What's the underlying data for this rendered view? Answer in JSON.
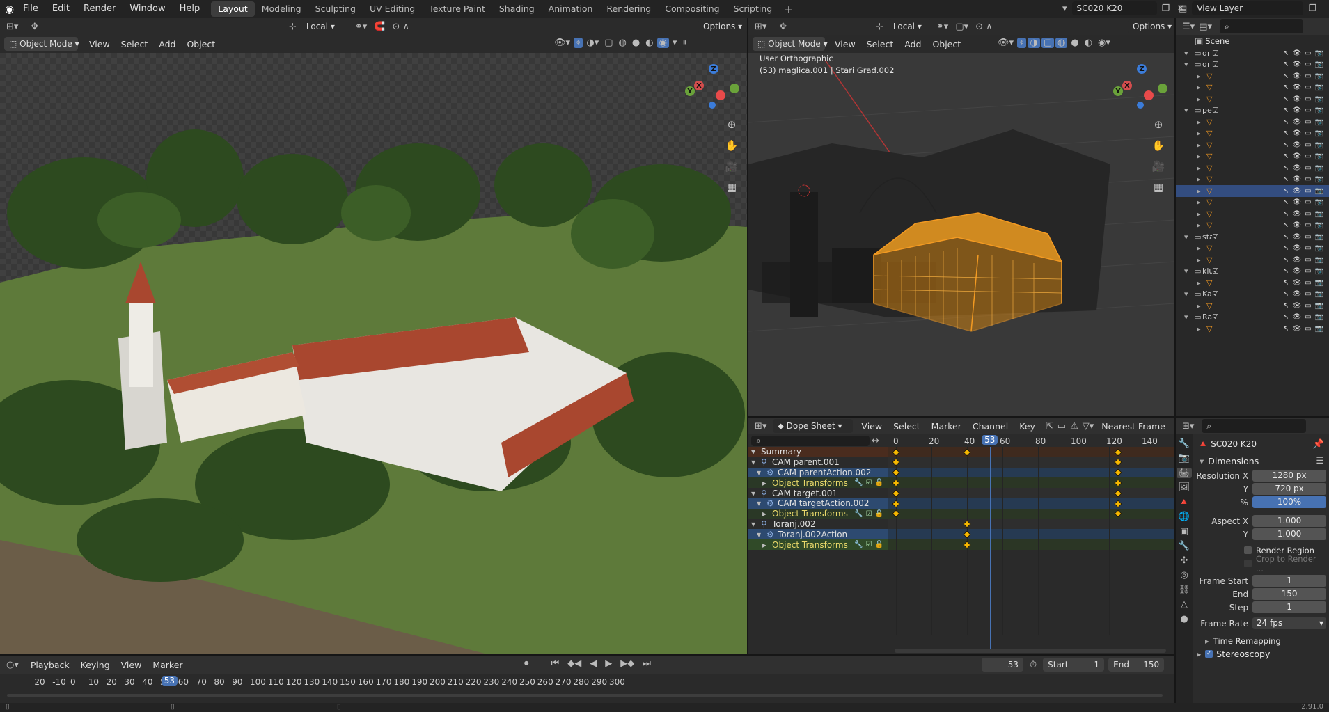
{
  "app_menu": [
    "File",
    "Edit",
    "Render",
    "Window",
    "Help"
  ],
  "workspaces": [
    "Layout",
    "Modeling",
    "Sculpting",
    "UV Editing",
    "Texture Paint",
    "Shading",
    "Animation",
    "Rendering",
    "Compositing",
    "Scripting"
  ],
  "scene_name": "SC020 K20",
  "view_layer": "View Layer",
  "transform_orientation": "Local",
  "options_label": "Options",
  "mode": "Object Mode",
  "viewport_menu": [
    "View",
    "Select",
    "Add",
    "Object"
  ],
  "right_viewport": {
    "view_name": "User Orthographic",
    "object_info": "(53) maglica.001 | Stari Grad.002"
  },
  "outliner": {
    "title": "Scene",
    "rows": [
      "dr",
      "dr",
      "",
      "",
      "",
      "pe",
      "",
      "",
      "",
      "",
      "",
      "",
      "",
      "",
      "",
      "",
      "sta",
      "",
      "",
      "klu",
      "",
      "Ka",
      "",
      "Ra",
      ""
    ]
  },
  "dopesheet": {
    "editor": "Dope Sheet",
    "menu": [
      "View",
      "Select",
      "Marker",
      "Channel",
      "Key"
    ],
    "snap": "Nearest Frame",
    "ruler": [
      "0",
      "20",
      "40",
      "60",
      "80",
      "100",
      "120",
      "140"
    ],
    "current_frame": "53",
    "channels": [
      {
        "label": "Summary",
        "type": "summary"
      },
      {
        "label": "CAM parent.001",
        "type": "object"
      },
      {
        "label": "CAM parentAction.002",
        "type": "action"
      },
      {
        "label": "Object Transforms",
        "type": "group"
      },
      {
        "label": "CAM target.001",
        "type": "object"
      },
      {
        "label": "CAM targetAction.002",
        "type": "action"
      },
      {
        "label": "Object Transforms",
        "type": "group"
      },
      {
        "label": "Toranj.002",
        "type": "object"
      },
      {
        "label": "Toranj.002Action",
        "type": "action"
      },
      {
        "label": "Object Transforms",
        "type": "group-active"
      }
    ],
    "keyframes": [
      [
        0,
        40,
        125
      ],
      [
        0,
        125
      ],
      [
        0,
        125
      ],
      [
        0,
        125
      ],
      [
        0,
        125
      ],
      [
        0,
        125
      ],
      [
        0,
        125
      ],
      [
        40
      ],
      [
        40
      ],
      [
        40
      ]
    ]
  },
  "properties": {
    "scene_name": "SC020 K20",
    "dimensions_title": "Dimensions",
    "res_x_label": "Resolution X",
    "res_x": "1280 px",
    "res_y_label": "Y",
    "res_y": "720 px",
    "pct_label": "%",
    "pct": "100%",
    "aspect_x_label": "Aspect X",
    "aspect_x": "1.000",
    "aspect_y_label": "Y",
    "aspect_y": "1.000",
    "render_region": "Render Region",
    "crop": "Crop to Render ...",
    "frame_start_label": "Frame Start",
    "frame_start": "1",
    "end_label": "End",
    "end": "150",
    "step_label": "Step",
    "step": "1",
    "frame_rate_label": "Frame Rate",
    "frame_rate": "24 fps",
    "time_remap": "Time Remapping",
    "stereoscopy": "Stereoscopy"
  },
  "timeline": {
    "menu": [
      "Playback",
      "Keying",
      "View",
      "Marker"
    ],
    "current": "53",
    "start_label": "Start",
    "start": "1",
    "end_label": "End",
    "end": "150",
    "ruler": [
      "20",
      "-10",
      "0",
      "10",
      "20",
      "30",
      "40",
      "50",
      "60",
      "70",
      "80",
      "90",
      "100",
      "110",
      "120",
      "130",
      "140",
      "150",
      "160",
      "170",
      "180",
      "190",
      "200",
      "210",
      "220",
      "230",
      "240",
      "250",
      "260",
      "270",
      "280",
      "290",
      "300"
    ]
  },
  "version": "2.91.0",
  "colors": {
    "accent": "#4772b3",
    "keyframe": "#f6b800",
    "selection": "#f39a22"
  }
}
